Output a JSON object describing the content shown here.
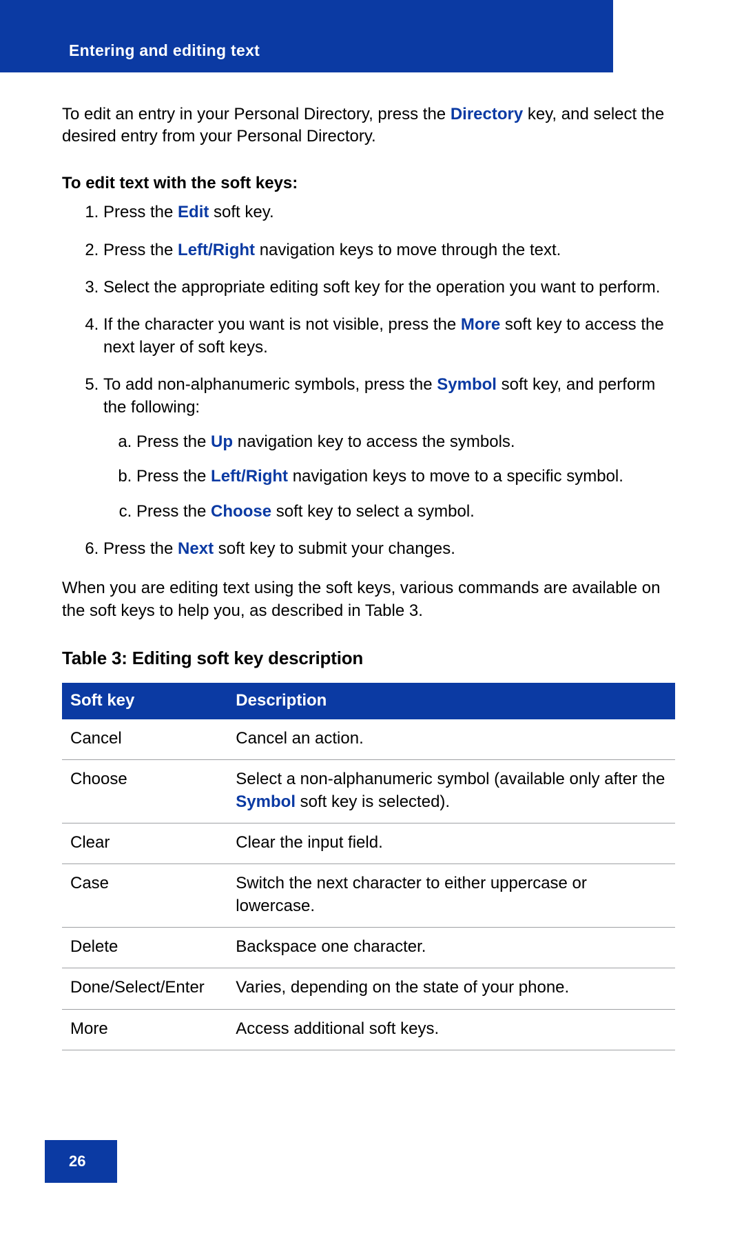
{
  "header": {
    "title": "Entering and editing text"
  },
  "intro": {
    "p1a": "To edit an entry in your Personal Directory, press the ",
    "p1k": "Directory",
    "p1b": " key, and select the desired entry from your Personal Directory."
  },
  "section1": {
    "heading": "To edit text with the soft keys:"
  },
  "steps": {
    "s1a": "Press the ",
    "s1k": "Edit",
    "s1b": " soft key.",
    "s2a": "Press the ",
    "s2k": "Left/Right",
    "s2b": " navigation keys to move through the text.",
    "s3": "Select the appropriate editing soft key for the operation you want to perform.",
    "s4a": "If the character you want is not visible, press the ",
    "s4k": "More",
    "s4b": " soft key to access the next layer of soft keys.",
    "s5a": "To add non-alphanumeric symbols, press the ",
    "s5k": "Symbol",
    "s5b": " soft key, and perform the following:",
    "sub_a_a": "Press the ",
    "sub_a_k": "Up",
    "sub_a_b": " navigation key to access the symbols.",
    "sub_b_a": "Press the ",
    "sub_b_k": "Left/Right",
    "sub_b_b": " navigation keys to move to a specific symbol.",
    "sub_c_a": "Press the ",
    "sub_c_k": "Choose",
    "sub_c_b": " soft key to select a symbol.",
    "s6a": "Press the ",
    "s6k": "Next",
    "s6b": " soft key to submit your changes."
  },
  "outro": "When you are editing text using the soft keys, various commands are available on the soft keys to help you, as described in Table 3.",
  "table": {
    "title": "Table 3: Editing soft key description",
    "head": {
      "c1": "Soft key",
      "c2": "Description"
    },
    "rows": {
      "r0c0": "Cancel",
      "r0c1": "Cancel an action.",
      "r1c0": "Choose",
      "r1c1a": "Select a non-alphanumeric symbol (available only after the ",
      "r1c1k": "Symbol",
      "r1c1b": " soft key is selected).",
      "r2c0": "Clear",
      "r2c1": "Clear the input field.",
      "r3c0": "Case",
      "r3c1": "Switch the next character to either uppercase or lowercase.",
      "r4c0": "Delete",
      "r4c1": "Backspace one character.",
      "r5c0": "Done/Select/Enter",
      "r5c1": "Varies, depending on the state of your phone.",
      "r6c0": "More",
      "r6c1": "Access additional soft keys."
    }
  },
  "footer": {
    "page": "26"
  }
}
